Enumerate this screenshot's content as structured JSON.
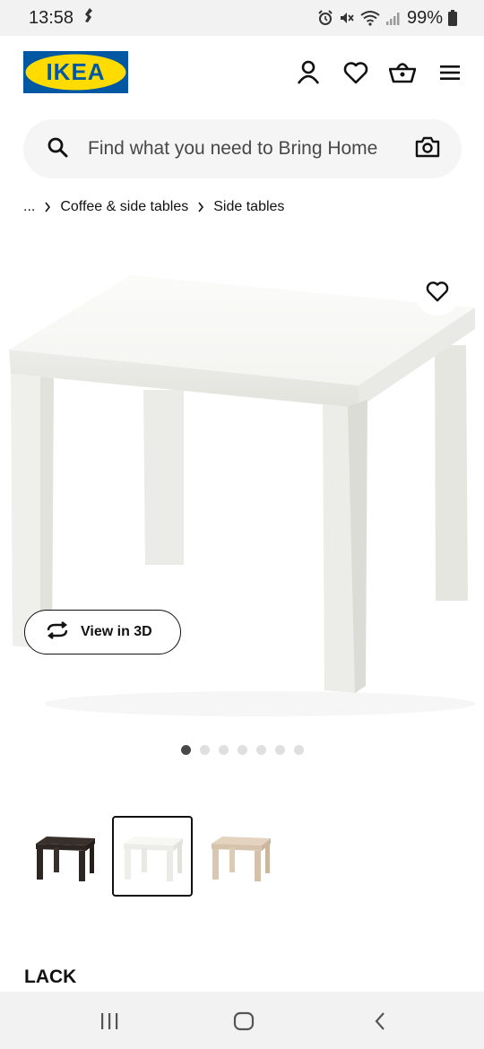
{
  "status_bar": {
    "time": "13:58",
    "battery": "99%"
  },
  "header": {
    "logo_text": "IKEA",
    "icons": [
      "account-icon",
      "heart-icon",
      "basket-icon",
      "menu-icon"
    ]
  },
  "search": {
    "placeholder": "Find what you need to Bring Home"
  },
  "breadcrumb": {
    "ellipsis": "...",
    "items": [
      "Coffee & side tables",
      "Side tables"
    ]
  },
  "gallery": {
    "view_3d_label": "View in 3D",
    "image_count": 7,
    "active_index": 0
  },
  "variants": [
    {
      "name": "black-brown",
      "color": "#2e2622",
      "selected": false
    },
    {
      "name": "white",
      "color": "#f3f3ef",
      "selected": true
    },
    {
      "name": "white stained oak effect",
      "color": "#d9c7b0",
      "selected": false
    }
  ],
  "product": {
    "name": "LACK"
  },
  "colors": {
    "ikea_blue": "#0058a3",
    "ikea_yellow": "#ffdb00"
  }
}
